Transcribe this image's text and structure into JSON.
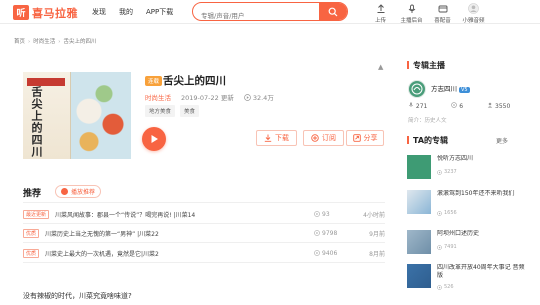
{
  "logo": {
    "mark": "听",
    "text": "喜马拉雅"
  },
  "nav": [
    "发现",
    "我的",
    "APP下载"
  ],
  "search": {
    "placeholder": "专辑/声音/用户"
  },
  "tools": [
    {
      "icon": "upload-icon",
      "label": "上传"
    },
    {
      "icon": "podcast-mic-icon",
      "label": "主播后台"
    },
    {
      "icon": "recharge-icon",
      "label": "喜配音"
    },
    {
      "icon": "user-icon",
      "label": "小雅音频"
    }
  ],
  "breadcrumb": [
    "首页",
    "时尚生活",
    "舌尖上的四川"
  ],
  "album": {
    "cover_title": "舌尖上的四川",
    "badge": "连载",
    "title": "舌尖上的四川",
    "category": "时尚生活",
    "date": "2019-07-22 更新",
    "plays": "32.4万",
    "tags": [
      "地方美食",
      "美食"
    ],
    "more": "▲",
    "actions": {
      "download": "下载",
      "subscribe": "订阅",
      "share": "分享"
    }
  },
  "recommend": {
    "title": "推荐",
    "play_all": "播放推荐"
  },
  "tracks": [
    {
      "tag": "最近更新",
      "title": "川菜风闻故事：郡县一个“传说”？喝完再说! |川菜14",
      "plays": "93",
      "time": "4小时前"
    },
    {
      "tag": "优质",
      "title": "川菜历史上当之无愧的第一“男神” |川菜22",
      "plays": "9798",
      "time": "9月前"
    },
    {
      "tag": "优质",
      "title": "川菜史上最大的一次机遇，竟然是它|川菜2",
      "plays": "9406",
      "time": "8月前"
    }
  ],
  "question": "没有辣椒的时代，川菜究竟啥味道?",
  "sidebar": {
    "anchor_header": "专辑主播",
    "anchor_name": "方志四川",
    "anchor_badge": "V5",
    "stats": [
      "271",
      "6",
      "3550"
    ],
    "intro": "简介：历史人文",
    "albums_header": "TA的专辑",
    "more": "更多",
    "albums": [
      {
        "name": "悦听方志四川",
        "count": "3237",
        "color": "#3e9b74"
      },
      {
        "name": "滚滚驾到150年还不来听我们",
        "count": "1656",
        "color": "#8bb6d6"
      },
      {
        "name": "阿坝州口述历史",
        "count": "7491",
        "color": "#6f8fa8"
      },
      {
        "name": "四川改革开放40周年大事记 音频版",
        "count": "526",
        "color": "#2f5e8f"
      }
    ]
  },
  "colors": {
    "accent": "#f86442",
    "tag_orange": "#f8a13a",
    "vip_blue": "#3d8fd8"
  }
}
